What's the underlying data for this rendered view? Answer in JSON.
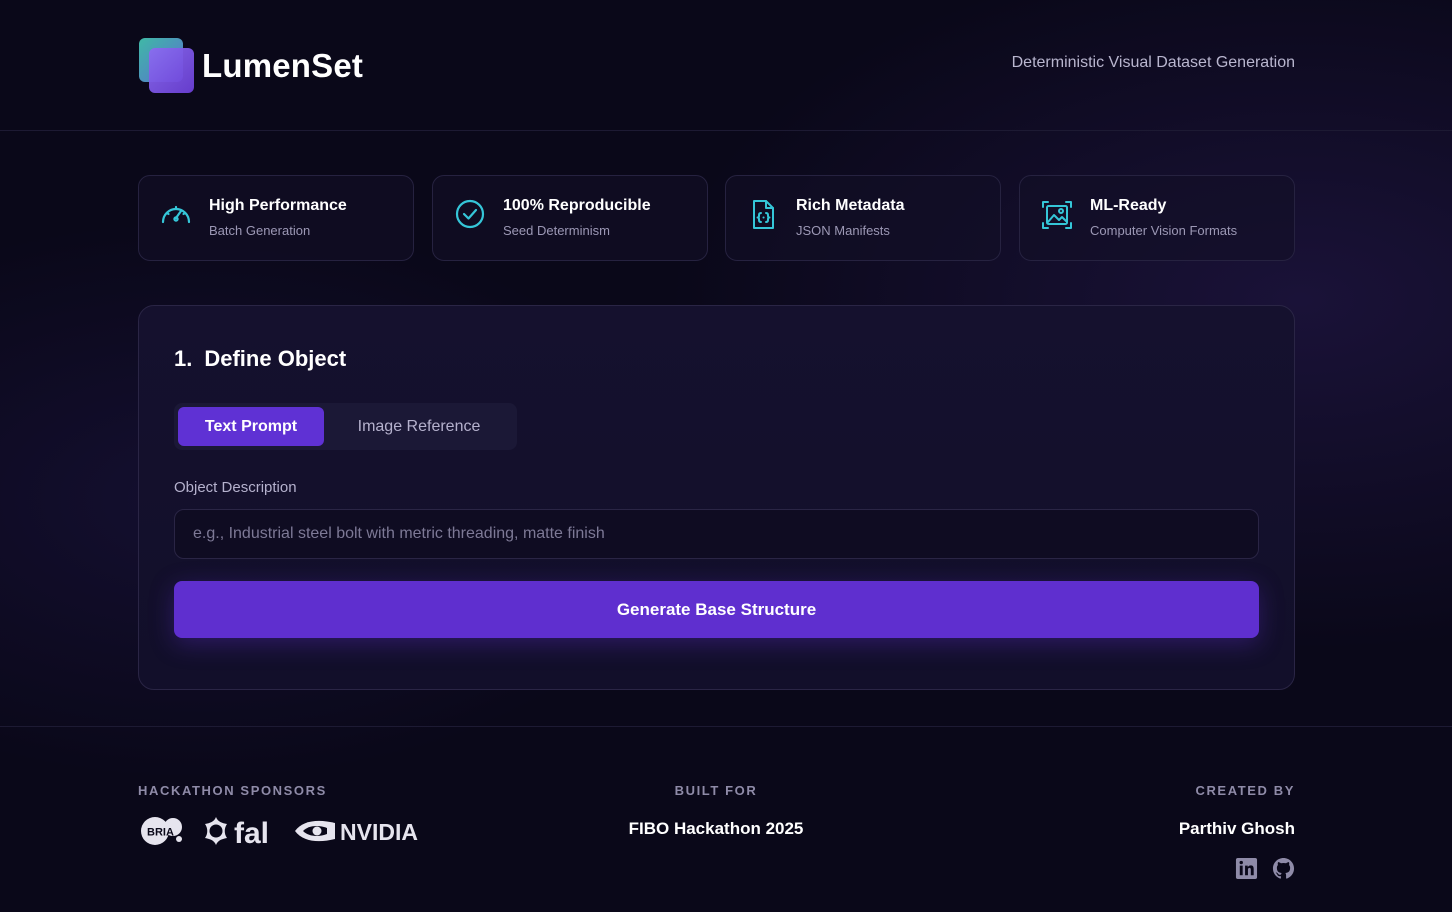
{
  "app": {
    "name": "LumenSet",
    "tagline": "Deterministic Visual Dataset Generation"
  },
  "features": [
    {
      "icon": "speedometer-icon",
      "title": "High Performance",
      "subtitle": "Batch Generation"
    },
    {
      "icon": "check-circle-icon",
      "title": "100% Reproducible",
      "subtitle": "Seed Determinism"
    },
    {
      "icon": "json-file-icon",
      "title": "Rich Metadata",
      "subtitle": "JSON Manifests"
    },
    {
      "icon": "image-scan-icon",
      "title": "ML-Ready",
      "subtitle": "Computer Vision Formats"
    }
  ],
  "panel": {
    "step_number": "1.",
    "title": "Define Object",
    "tabs": [
      {
        "label": "Text Prompt",
        "active": true
      },
      {
        "label": "Image Reference",
        "active": false
      }
    ],
    "field_label": "Object Description",
    "input_value": "",
    "input_placeholder": "e.g., Industrial steel bolt with metric threading, matte finish",
    "generate_label": "Generate Base Structure"
  },
  "footer": {
    "sponsors_heading": "HACKATHON SPONSORS",
    "sponsors": [
      "BRIA",
      "fal",
      "NVIDIA"
    ],
    "built_heading": "BUILT FOR",
    "built_value": "FIBO Hackathon 2025",
    "created_heading": "CREATED BY",
    "created_value": "Parthiv Ghosh",
    "socials": [
      "linkedin-icon",
      "github-icon"
    ]
  },
  "colors": {
    "background": "#0a0819",
    "accent": "#5f31d4",
    "icon_accent": "#35c6d8",
    "muted_text": "#9c98b5"
  }
}
